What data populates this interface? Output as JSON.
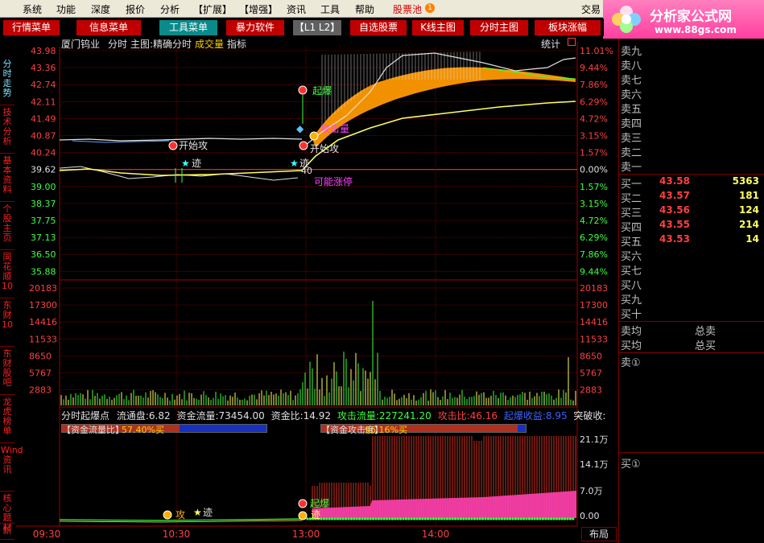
{
  "menu": [
    "系统",
    "功能",
    "深度",
    "报价",
    "分析",
    "【扩展】",
    "【增强】",
    "资讯",
    "工具",
    "帮助",
    "股票池",
    "交易"
  ],
  "logo": {
    "title": "分析家公式网",
    "url": "www.88gs.com"
  },
  "tabs": [
    {
      "label": "行情菜单",
      "color": "#c00000"
    },
    {
      "label": "信息菜单",
      "color": "#c00000"
    },
    {
      "label": "工具菜单",
      "color": "#0a8a8a"
    },
    {
      "label": "暴力软件",
      "color": "#c00000"
    },
    {
      "label": "【L1 L2】",
      "color": "#606060"
    },
    {
      "label": "自选股票",
      "color": "#c00000"
    },
    {
      "label": "K线主图",
      "color": "#c00000"
    },
    {
      "label": "分时主图",
      "color": "#c00000"
    },
    {
      "label": "板块涨幅",
      "color": "#c00000"
    }
  ],
  "left_tabs": [
    {
      "label": "分时走势",
      "selected": true
    },
    {
      "label": "技术分析",
      "selected": false
    },
    {
      "label": "基本资料",
      "selected": false
    },
    {
      "label": "个股主页",
      "selected": false
    },
    {
      "label": "同花顺10",
      "selected": false
    },
    {
      "label": "东财10",
      "selected": false
    },
    {
      "label": "东财股吧",
      "selected": false
    },
    {
      "label": "龙虎榜单",
      "selected": false
    },
    {
      "label": "Wind资讯",
      "selected": false
    },
    {
      "label": "核心题材",
      "selected": false
    },
    {
      "label": "新",
      "selected": false
    }
  ],
  "header": {
    "stock_name": "厦门钨业",
    "mode": "分时",
    "main_label": "主图:精确分时",
    "volume_label": "成交量",
    "indicator_label": "指标",
    "stat_label": "统计"
  },
  "price_axis": {
    "left": [
      "43.98",
      "43.36",
      "42.74",
      "42.11",
      "41.49",
      "40.87",
      "40.24",
      "39.62",
      "39.00",
      "38.37",
      "37.75",
      "37.13",
      "36.50",
      "35.88"
    ],
    "right": [
      "11.01%",
      "9.44%",
      "7.86%",
      "6.29%",
      "4.72%",
      "3.15%",
      "1.57%",
      "0.00%",
      "1.57%",
      "3.15%",
      "4.72%",
      "6.29%",
      "7.86%",
      "9.44%"
    ]
  },
  "volume_axis": [
    "20183",
    "17300",
    "14416",
    "11533",
    "8650",
    "5767",
    "2883"
  ],
  "annotations": {
    "start_attack_1": "开始攻",
    "trace_1": "迹",
    "rise_up": "起爆",
    "attack_volume": "攻击量",
    "start_attack_2": "开始攻",
    "trace_2": "迹",
    "possible_limit": "可能涨停",
    "sub_label_40": "40"
  },
  "indicator": {
    "title": "分时起爆点",
    "float_label": "流通盘:",
    "float_value": "6.82",
    "money_flow_label": "资金流量:",
    "money_flow_value": "73454.00",
    "money_ratio_label": "资金比:",
    "money_ratio_value": "14.92",
    "attack_flow_label": "攻击流量:",
    "attack_flow_value": "227241.20",
    "attack_ratio_label": "攻击比:",
    "attack_ratio_value": "46.16",
    "rise_gain_label": "起爆收益:",
    "rise_gain_value": "8.95",
    "break_label": "突破收:",
    "bar1_label": "【资金流量比】",
    "bar1_value": "57.40%买",
    "bar1_fraction": 0.574,
    "bar2_label": "【资金攻击度】",
    "bar2_value": "96.16%买",
    "bar2_fraction": 0.9616,
    "right_axis": [
      "21.1万",
      "14.1万",
      "7.0万",
      "0.00"
    ],
    "markers": {
      "rise_up": "起爆",
      "trace": "迹",
      "attack": "攻"
    }
  },
  "time_axis": [
    "09:30",
    "10:30",
    "13:00",
    "14:00"
  ],
  "layout_button": "布局",
  "quote": {
    "sell": [
      "卖九",
      "卖八",
      "卖七",
      "卖六",
      "卖五",
      "卖四",
      "卖三",
      "卖二",
      "卖一"
    ],
    "buy": [
      {
        "label": "买一",
        "price": "43.58",
        "vol": "5363"
      },
      {
        "label": "买二",
        "price": "43.57",
        "vol": "181"
      },
      {
        "label": "买三",
        "price": "43.56",
        "vol": "124"
      },
      {
        "label": "买四",
        "price": "43.55",
        "vol": "214"
      },
      {
        "label": "买五",
        "price": "43.53",
        "vol": "14"
      },
      {
        "label": "买六",
        "price": "",
        "vol": ""
      },
      {
        "label": "买七",
        "price": "",
        "vol": ""
      },
      {
        "label": "买八",
        "price": "",
        "vol": ""
      },
      {
        "label": "买九",
        "price": "",
        "vol": ""
      },
      {
        "label": "买十",
        "price": "",
        "vol": ""
      }
    ],
    "sell_avg": "卖均",
    "buy_avg": "买均",
    "total_sell": "总卖",
    "total_buy": "总买",
    "sell_queue": "卖①",
    "buy_queue": "买①"
  },
  "colors": {
    "up": "#ff4040",
    "down": "#40ff40",
    "grid": "#a00000",
    "price_line": "#ffffff",
    "avg_line": "#ffff60",
    "orange_band": "#ff9900"
  }
}
